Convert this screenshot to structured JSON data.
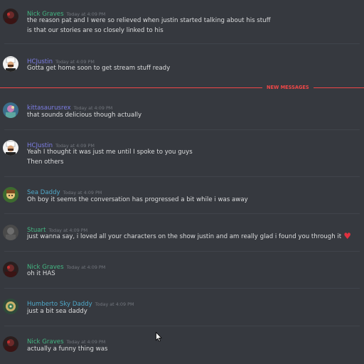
{
  "colors": {
    "background": "#36393f",
    "green_user": "#43b581",
    "purple_user": "#7d7ee6",
    "teal_user": "#4fa8c8",
    "timestamp": "#72767d",
    "message_text": "#dcddde",
    "new_messages": "#f04747"
  },
  "new_messages_label": "NEW MESSAGES",
  "heart_icon": "red-heart-emoji",
  "messages": [
    {
      "user": "Nick Graves",
      "time": "Today at 4:09 PM",
      "lines": [
        "the reason pat and I were so relieved when justin started talking about his stuff",
        "is that our stories are so closely linked to his"
      ]
    },
    {
      "user": "HCJustin",
      "time": "Today at 4:09 PM",
      "lines": [
        "Gotta get home soon to get stream stuff ready"
      ]
    },
    {
      "user": "kittasaurusrex",
      "time": "Today at 4:09 PM",
      "lines": [
        "that sounds delicious though actually"
      ]
    },
    {
      "user": "HCJustin",
      "time": "Today at 4:09 PM",
      "lines": [
        "Yeah I thought it was just me until I spoke to you guys",
        "Then others"
      ]
    },
    {
      "user": "Sea Daddy",
      "time": "Today at 4:09 PM",
      "lines": [
        "Oh boy it seems the conversation has progressed a bit while i was away"
      ]
    },
    {
      "user": "Stuart",
      "time": "Today at 4:09 PM",
      "lines": [
        "just wanna say, i loved all your characters on the show justin and am really glad i found you through it"
      ]
    },
    {
      "user": "Nick Graves",
      "time": "Today at 4:09 PM",
      "lines": [
        "oh it HAS"
      ]
    },
    {
      "user": "Humberto Sky Daddy",
      "time": "Today at 4:09 PM",
      "lines": [
        "just a bit sea daddy"
      ]
    },
    {
      "user": "Nick Graves",
      "time": "Today at 4:09 PM",
      "lines": [
        "actually a funny thing was"
      ]
    }
  ]
}
